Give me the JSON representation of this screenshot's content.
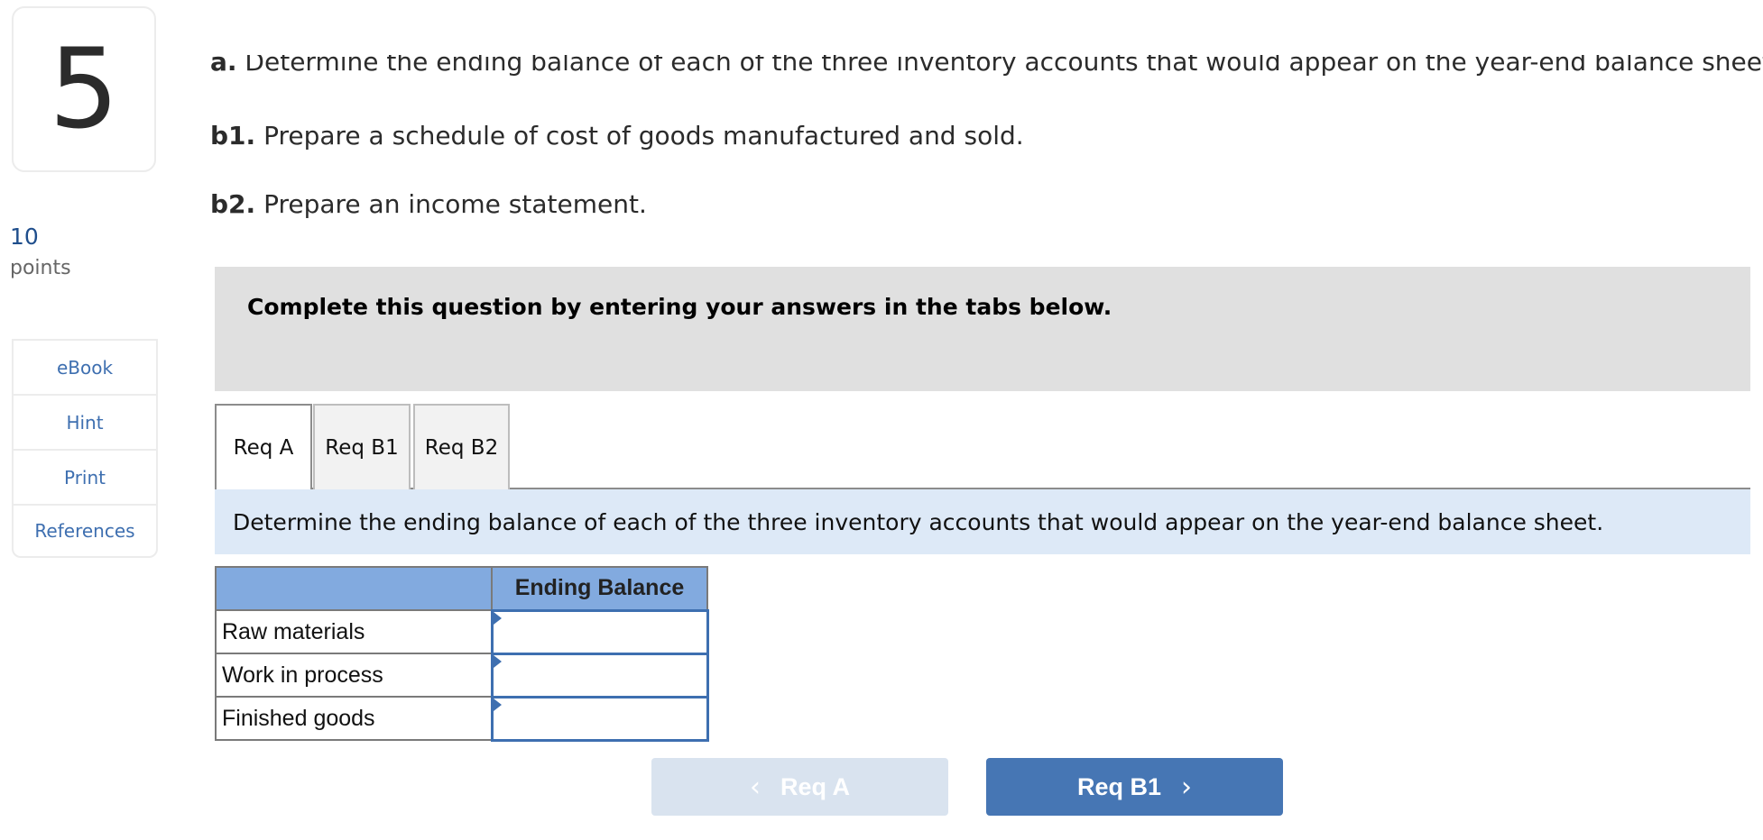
{
  "question": {
    "number": "5",
    "points_value": "10",
    "points_label": "points"
  },
  "tools": [
    {
      "label": "eBook"
    },
    {
      "label": "Hint"
    },
    {
      "label": "Print"
    },
    {
      "label": "References"
    }
  ],
  "requirements": {
    "a": {
      "prefix": "a.",
      "text": " Determine the ending balance of each of the three inventory accounts that would appear on the year-end balance sheet."
    },
    "b1": {
      "prefix": "b1.",
      "text": " Prepare a schedule of cost of goods manufactured and sold."
    },
    "b2": {
      "prefix": "b2.",
      "text": " Prepare an income statement."
    }
  },
  "banner": "Complete this question by entering your answers in the tabs below.",
  "tabs": [
    {
      "label": "Req A",
      "active": true
    },
    {
      "label": "Req B1",
      "active": false
    },
    {
      "label": "Req B2",
      "active": false
    }
  ],
  "instruction": "Determine the ending balance of each of the three inventory accounts that would appear on the year-end balance sheet.",
  "table": {
    "headers": [
      "",
      "Ending Balance"
    ],
    "rows": [
      {
        "label": "Raw materials",
        "value": ""
      },
      {
        "label": "Work in process",
        "value": ""
      },
      {
        "label": "Finished goods",
        "value": ""
      }
    ]
  },
  "nav": {
    "prev_label": "Req A",
    "prev_enabled": false,
    "next_label": "Req B1",
    "next_enabled": true,
    "prev_icon": "chevron-left-icon",
    "next_icon": "chevron-right-icon"
  },
  "colors": {
    "accent": "#4676b4",
    "link": "#3e6fb0",
    "table_header": "#82aadf",
    "instruction_bg": "#dde9f7",
    "banner_bg": "#e0e0e0"
  }
}
